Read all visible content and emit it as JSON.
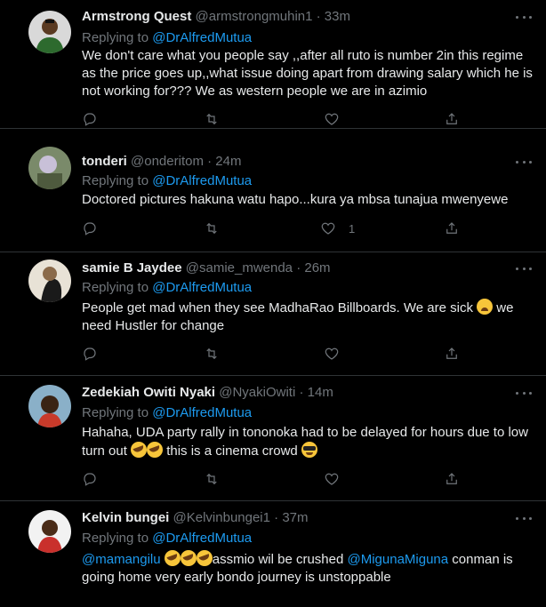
{
  "tweets": [
    {
      "name": "Armstrong Quest",
      "handle": "@armstrongmuhin1 · 33m",
      "replying_prefix": "Replying to ",
      "replying_to": "@DrAlfredMutua",
      "body": "We don't care what you people say ,,after all ruto is number 2in this regime as the price goes up,,what issue doing apart from drawing salary which he is not working for??? We as western people we are in azimio",
      "like_count": ""
    },
    {
      "name": "tonderi",
      "handle": "@onderitom · 24m",
      "replying_prefix": "Replying to ",
      "replying_to": "@DrAlfredMutua",
      "body": "Doctored pictures hakuna watu hapo...kura ya mbsa tunajua mwenyewe",
      "like_count": "1"
    },
    {
      "name": "samie B Jaydee",
      "handle": "@samie_mwenda · 26m",
      "replying_prefix": "Replying to ",
      "replying_to": "@DrAlfredMutua",
      "body_a": "People get mad when they see MadhaRao Billboards.  We are sick ",
      "body_b": "  we need Hustler for change",
      "emoji": "tired-face-emoji",
      "like_count": ""
    },
    {
      "name": "Zedekiah Owiti Nyaki",
      "handle": "@NyakiOwiti · 14m",
      "replying_prefix": "Replying to ",
      "replying_to": "@DrAlfredMutua",
      "body_a": "Hahaha, UDA party rally in tononoka had to be delayed for hours due to low turn out ",
      "body_b": " this is a cinema crowd ",
      "emoji_a": "rolling-laughing-emoji",
      "emoji_b": "sunglasses-emoji",
      "like_count": ""
    },
    {
      "name": "Kelvin bungei",
      "handle": "@Kelvinbungei1 · 37m",
      "replying_prefix": "Replying to ",
      "replying_to": "@DrAlfredMutua",
      "mention_a": "@mamangilu",
      "body_a": "assmio wil be crushed ",
      "mention_b": "@MigunaMiguna",
      "body_b": " conman is going home very early bondo journey is unstoppable",
      "emoji": "rolling-laughing-emoji"
    }
  ],
  "colors": {
    "background": "#000000",
    "text": "#e7e9ea",
    "muted": "#71767b",
    "link": "#1d9bf0",
    "divider": "#2f3336"
  },
  "icons": [
    "reply-icon",
    "retweet-icon",
    "like-icon",
    "share-icon",
    "more-icon"
  ]
}
